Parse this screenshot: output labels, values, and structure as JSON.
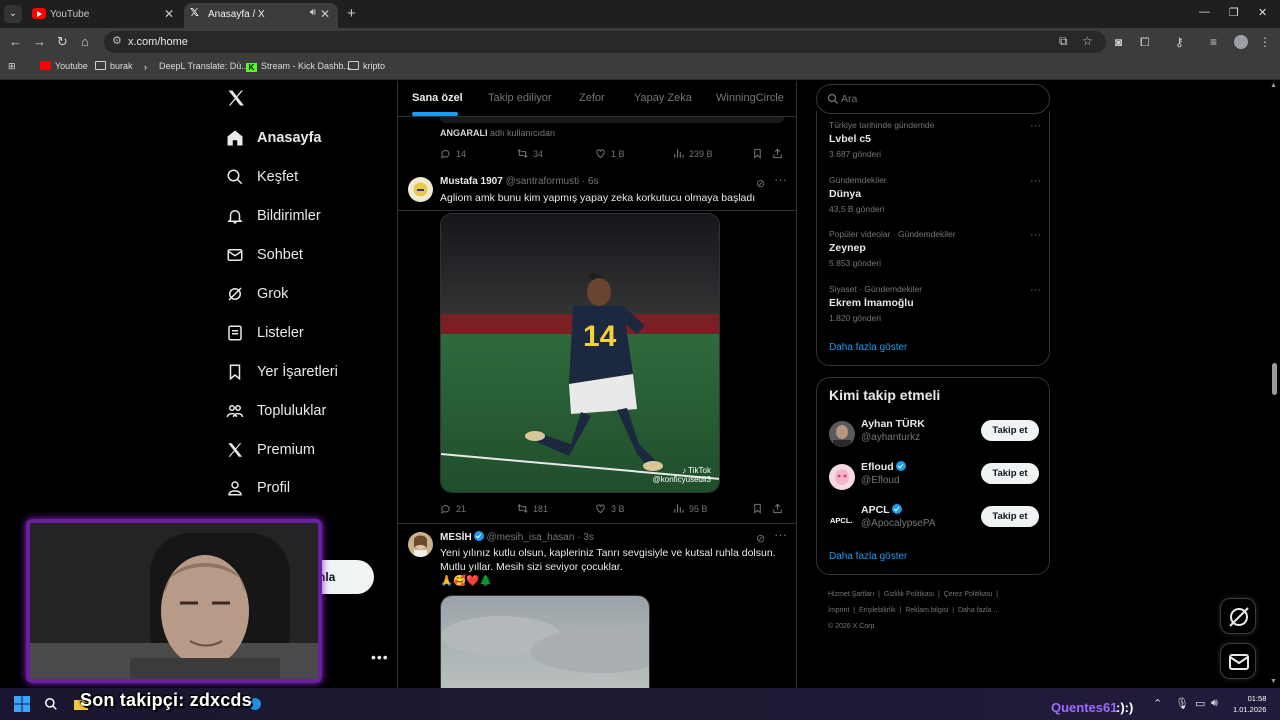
{
  "browser": {
    "tabs": [
      {
        "label": "YouTube",
        "icon": "youtube-icon"
      },
      {
        "label": "Anasayfa / X",
        "icon": "x-icon",
        "active": true
      }
    ],
    "url": "x.com/home",
    "bookmarks": [
      "Youtube",
      "burak",
      "DeepL Translate: Dü...",
      "Stream - Kick Dashb...",
      "kripto"
    ]
  },
  "nav": {
    "items": [
      {
        "label": "Anasayfa",
        "icon": "home-icon"
      },
      {
        "label": "Keşfet",
        "icon": "search-icon"
      },
      {
        "label": "Bildirimler",
        "icon": "bell-icon"
      },
      {
        "label": "Sohbet",
        "icon": "mail-icon"
      },
      {
        "label": "Grok",
        "icon": "grok-icon"
      },
      {
        "label": "Listeler",
        "icon": "list-icon"
      },
      {
        "label": "Yer İşaretleri",
        "icon": "bookmark-icon"
      },
      {
        "label": "Topluluklar",
        "icon": "communities-icon"
      },
      {
        "label": "Premium",
        "icon": "x-icon"
      },
      {
        "label": "Profil",
        "icon": "profile-icon"
      }
    ],
    "post_button_partial": "nla"
  },
  "feed": {
    "tabs": [
      "Sana özel",
      "Takip ediliyor",
      "Zefor",
      "Yapay Zeka",
      "WinningCircle"
    ],
    "previous": {
      "retweet_user": "ANGARALI",
      "retweet_suffix": "adlı kullanıcıdan",
      "replies": "14",
      "reposts": "34",
      "likes": "1 B",
      "views": "239 B"
    },
    "tweets": [
      {
        "name": "Mustafa 1907",
        "handle": "@santraformusti · 6s",
        "text": "Agliom amk bunu kim yapmış yapay zeka korkutucu olmaya başladı",
        "jersey": "14",
        "tiktok_label": "TikTok",
        "tiktok_user": "@konficyusedil3",
        "replies": "21",
        "reposts": "181",
        "likes": "3 B",
        "views": "95 B"
      },
      {
        "name": "MESİH",
        "handle": "@mesih_isa_hasan · 3s",
        "text": "Yeni yılınız kutlu olsun, kapleriniz Tanrı sevgisiyle ve kutsal ruhla dolsun. Mutlu yıllar. Mesih sizi seviyor çocuklar.",
        "emojis": "🙏🥰❤️🌲"
      }
    ]
  },
  "sidebar": {
    "search_placeholder": "Ara",
    "trends": [
      {
        "context": "Türkiye tarihinde gündemde",
        "name": "Lvbel c5",
        "count": "3.687 gönderi"
      },
      {
        "context": "Gündemdekiler",
        "name": "Dünya",
        "count": "43,5 B gönderi"
      },
      {
        "context": "Popüler videolar · Gündemdekiler",
        "name": "Zeynep",
        "count": "5.853 gönderi"
      },
      {
        "context": "Siyaset · Gündemdekiler",
        "name": "Ekrem İmamoğlu",
        "count": "1.820 gönderi"
      }
    ],
    "show_more": "Daha fazla göster",
    "who_to_follow": {
      "title": "Kimi takip etmeli",
      "accounts": [
        {
          "name": "Ayhan TÜRK",
          "handle": "@ayhanturkz",
          "verified": false
        },
        {
          "name": "Efloud",
          "handle": "@Efloud",
          "verified": true
        },
        {
          "name": "APCL",
          "handle": "@ApocalypsePA",
          "verified": true,
          "avatar_text": "APCL."
        }
      ],
      "follow_label": "Takip et",
      "show_more": "Daha fazla göster"
    },
    "footer": {
      "links": [
        "Hizmet Şartları",
        "Gizlilik Politikası",
        "Çerez Politikası",
        "İmprint",
        "Erişilebilirlik",
        "Reklam bilgisi",
        "Daha fazla ..."
      ],
      "copyright": "© 2026 X Corp."
    }
  },
  "overlay": {
    "last_follower": "Son takipçi: zdxcds",
    "streamer": "Quentes61",
    "emote": ":):)"
  },
  "taskbar": {
    "time": "01:58",
    "date": "1.01.2026"
  },
  "colors": {
    "accent": "#1d9bf0",
    "background": "#000000",
    "webcam_border": "#6a1fa0",
    "streamer_name": "#9c6bff"
  }
}
